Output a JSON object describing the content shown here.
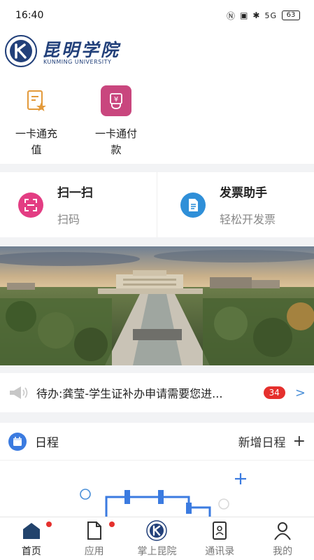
{
  "status_bar": {
    "time": "16:40",
    "signal": "5G",
    "battery": "63"
  },
  "header": {
    "logo_cn": "昆明学院",
    "logo_en": "KUNMING UNIVERSITY",
    "emblem_text": "K"
  },
  "quick_actions": [
    {
      "label": "一卡通充值",
      "icon": "card-recharge-icon",
      "color": "#e9b25a"
    },
    {
      "label": "一卡通付款",
      "icon": "card-payment-icon",
      "color": "#c9467e"
    }
  ],
  "tools": {
    "scan": {
      "title": "扫一扫",
      "subtitle": "扫码",
      "icon": "scan-icon",
      "color": "#e33d83"
    },
    "invoice": {
      "title": "发票助手",
      "subtitle": "轻松开发票",
      "icon": "invoice-icon",
      "color": "#2f8fd8"
    }
  },
  "notice": {
    "text": "待办:龚莹-学生证补办申请需要您进...",
    "count": "34",
    "arrow": ">"
  },
  "schedule": {
    "title": "日程",
    "add_label": "新增日程",
    "add_icon": "+"
  },
  "bottom_nav": [
    {
      "label": "首页",
      "icon": "home-icon",
      "dot": true
    },
    {
      "label": "应用",
      "icon": "apps-icon",
      "dot": true
    },
    {
      "label": "掌上昆院",
      "icon": "campus-logo-icon",
      "dot": false
    },
    {
      "label": "通讯录",
      "icon": "contacts-icon",
      "dot": false
    },
    {
      "label": "我的",
      "icon": "profile-icon",
      "dot": false
    }
  ]
}
